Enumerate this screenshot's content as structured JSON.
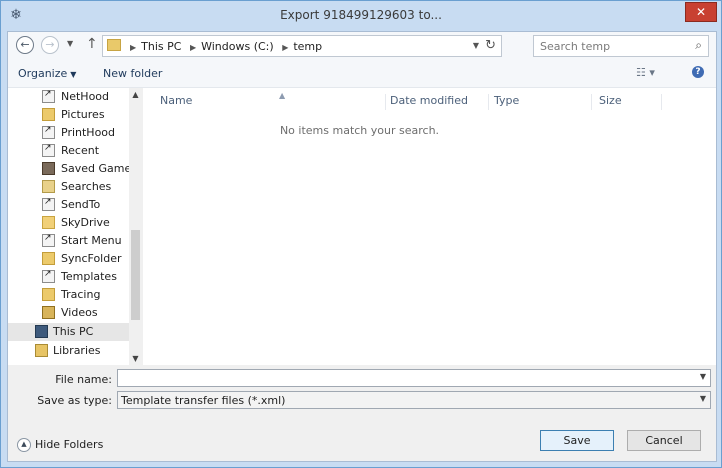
{
  "window": {
    "title": "Export 918499129603 to...",
    "close_glyph": "✕",
    "app_icon": "snowflake-icon"
  },
  "navbar": {
    "back_glyph": "←",
    "forward_glyph": "→",
    "recent_glyph": "▼",
    "up_glyph": "↑",
    "breadcrumb": [
      "This PC",
      "Windows (C:)",
      "temp"
    ],
    "crumb_sep": "▶",
    "search_placeholder": "Search temp"
  },
  "toolbar": {
    "organize_label": "Organize",
    "new_folder_label": "New folder"
  },
  "nav_pane": {
    "items": [
      {
        "label": "NetHood",
        "icon": "shortcut"
      },
      {
        "label": "Pictures",
        "icon": "folder"
      },
      {
        "label": "PrintHood",
        "icon": "shortcut"
      },
      {
        "label": "Recent",
        "icon": "shortcut"
      },
      {
        "label": "Saved Games",
        "icon": "games"
      },
      {
        "label": "Searches",
        "icon": "search"
      },
      {
        "label": "SendTo",
        "icon": "shortcut"
      },
      {
        "label": "SkyDrive",
        "icon": "sky"
      },
      {
        "label": "Start Menu",
        "icon": "shortcut"
      },
      {
        "label": "SyncFolder",
        "icon": "folder"
      },
      {
        "label": "Templates",
        "icon": "shortcut"
      },
      {
        "label": "Tracing",
        "icon": "folder"
      },
      {
        "label": "Videos",
        "icon": "video"
      }
    ],
    "top_items": [
      {
        "label": "This PC",
        "icon": "pc",
        "selected": true
      },
      {
        "label": "Libraries",
        "icon": "lib",
        "selected": false
      }
    ]
  },
  "file_list": {
    "columns": [
      "Name",
      "Date modified",
      "Type",
      "Size"
    ],
    "empty_message": "No items match your search."
  },
  "form": {
    "filename_label": "File name:",
    "filename_value": "",
    "savetype_label": "Save as type:",
    "savetype_value": "Template transfer files (*.xml)"
  },
  "footer": {
    "hide_folders_label": "Hide Folders",
    "save_label": "Save",
    "cancel_label": "Cancel"
  }
}
